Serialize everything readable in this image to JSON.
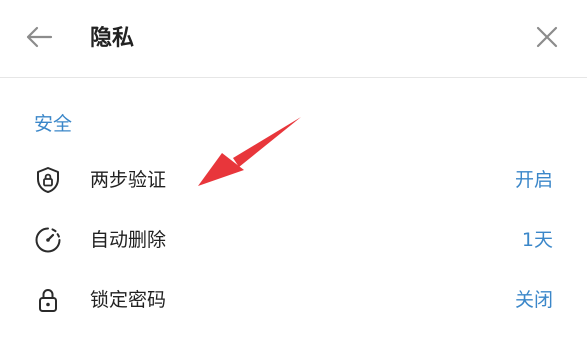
{
  "header": {
    "title": "隐私",
    "back_icon": "arrow-left-icon",
    "close_icon": "close-icon"
  },
  "section": {
    "title": "安全"
  },
  "rows": [
    {
      "icon": "shield-lock-icon",
      "label": "两步验证",
      "value": "开启"
    },
    {
      "icon": "timer-icon",
      "label": "自动删除",
      "value": "1天"
    },
    {
      "icon": "padlock-icon",
      "label": "锁定密码",
      "value": "关闭"
    }
  ],
  "colors": {
    "accent": "#3b87c9",
    "text": "#222222",
    "icon": "#2b2b2b",
    "annotation_arrow": "#e8363b"
  }
}
